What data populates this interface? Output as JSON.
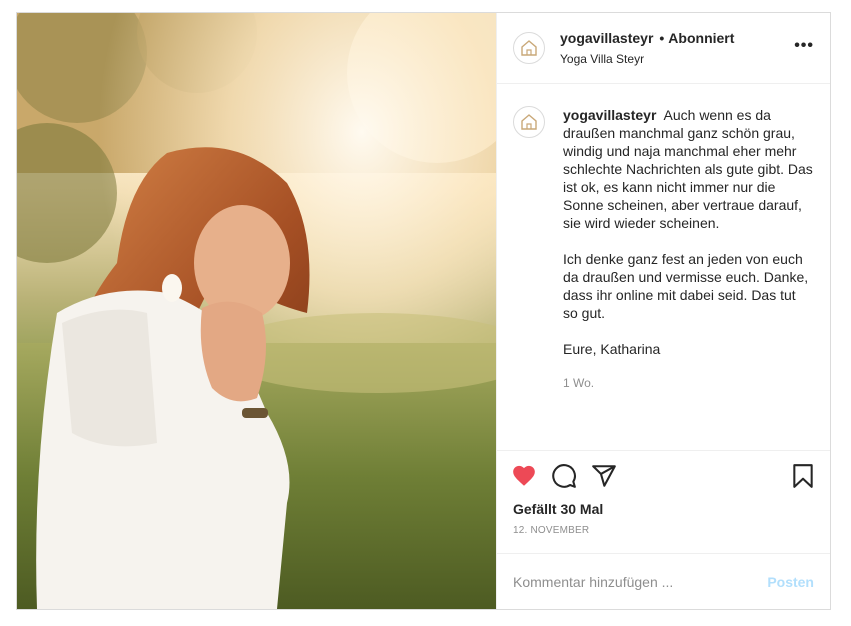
{
  "post": {
    "photo": {
      "description_icon": "photo-image"
    },
    "header": {
      "username": "yogavillasteyr",
      "separator": "•",
      "follow_state": "Abonniert",
      "subtitle": "Yoga Villa Steyr",
      "more_icon": "more-horizontal-icon",
      "more_label": "•••"
    },
    "caption": {
      "username": "yogavillasteyr",
      "paragraphs": [
        "Auch wenn es da draußen manchmal ganz schön grau, windig und naja manchmal eher mehr schlechte Nachrichten als gute gibt. Das ist ok, es kann nicht immer nur die Sonne scheinen, aber vertraue darauf, sie wird wieder scheinen.",
        "Ich denke ganz fest an jeden von euch da draußen und vermisse euch. Danke, dass ihr online mit dabei seid. Das tut so gut.",
        "Eure, Katharina"
      ],
      "time": "1 Wo."
    },
    "actions": {
      "like_icon": "heart-filled-icon",
      "comment_icon": "comment-icon",
      "share_icon": "send-icon",
      "save_icon": "bookmark-icon",
      "liked_color": "#ed4956"
    },
    "likes": "Gefällt 30 Mal",
    "date": "12. NOVEMBER",
    "add_comment": {
      "placeholder": "Kommentar hinzufügen ...",
      "post_label": "Posten",
      "post_color": "#b2dffc"
    }
  }
}
